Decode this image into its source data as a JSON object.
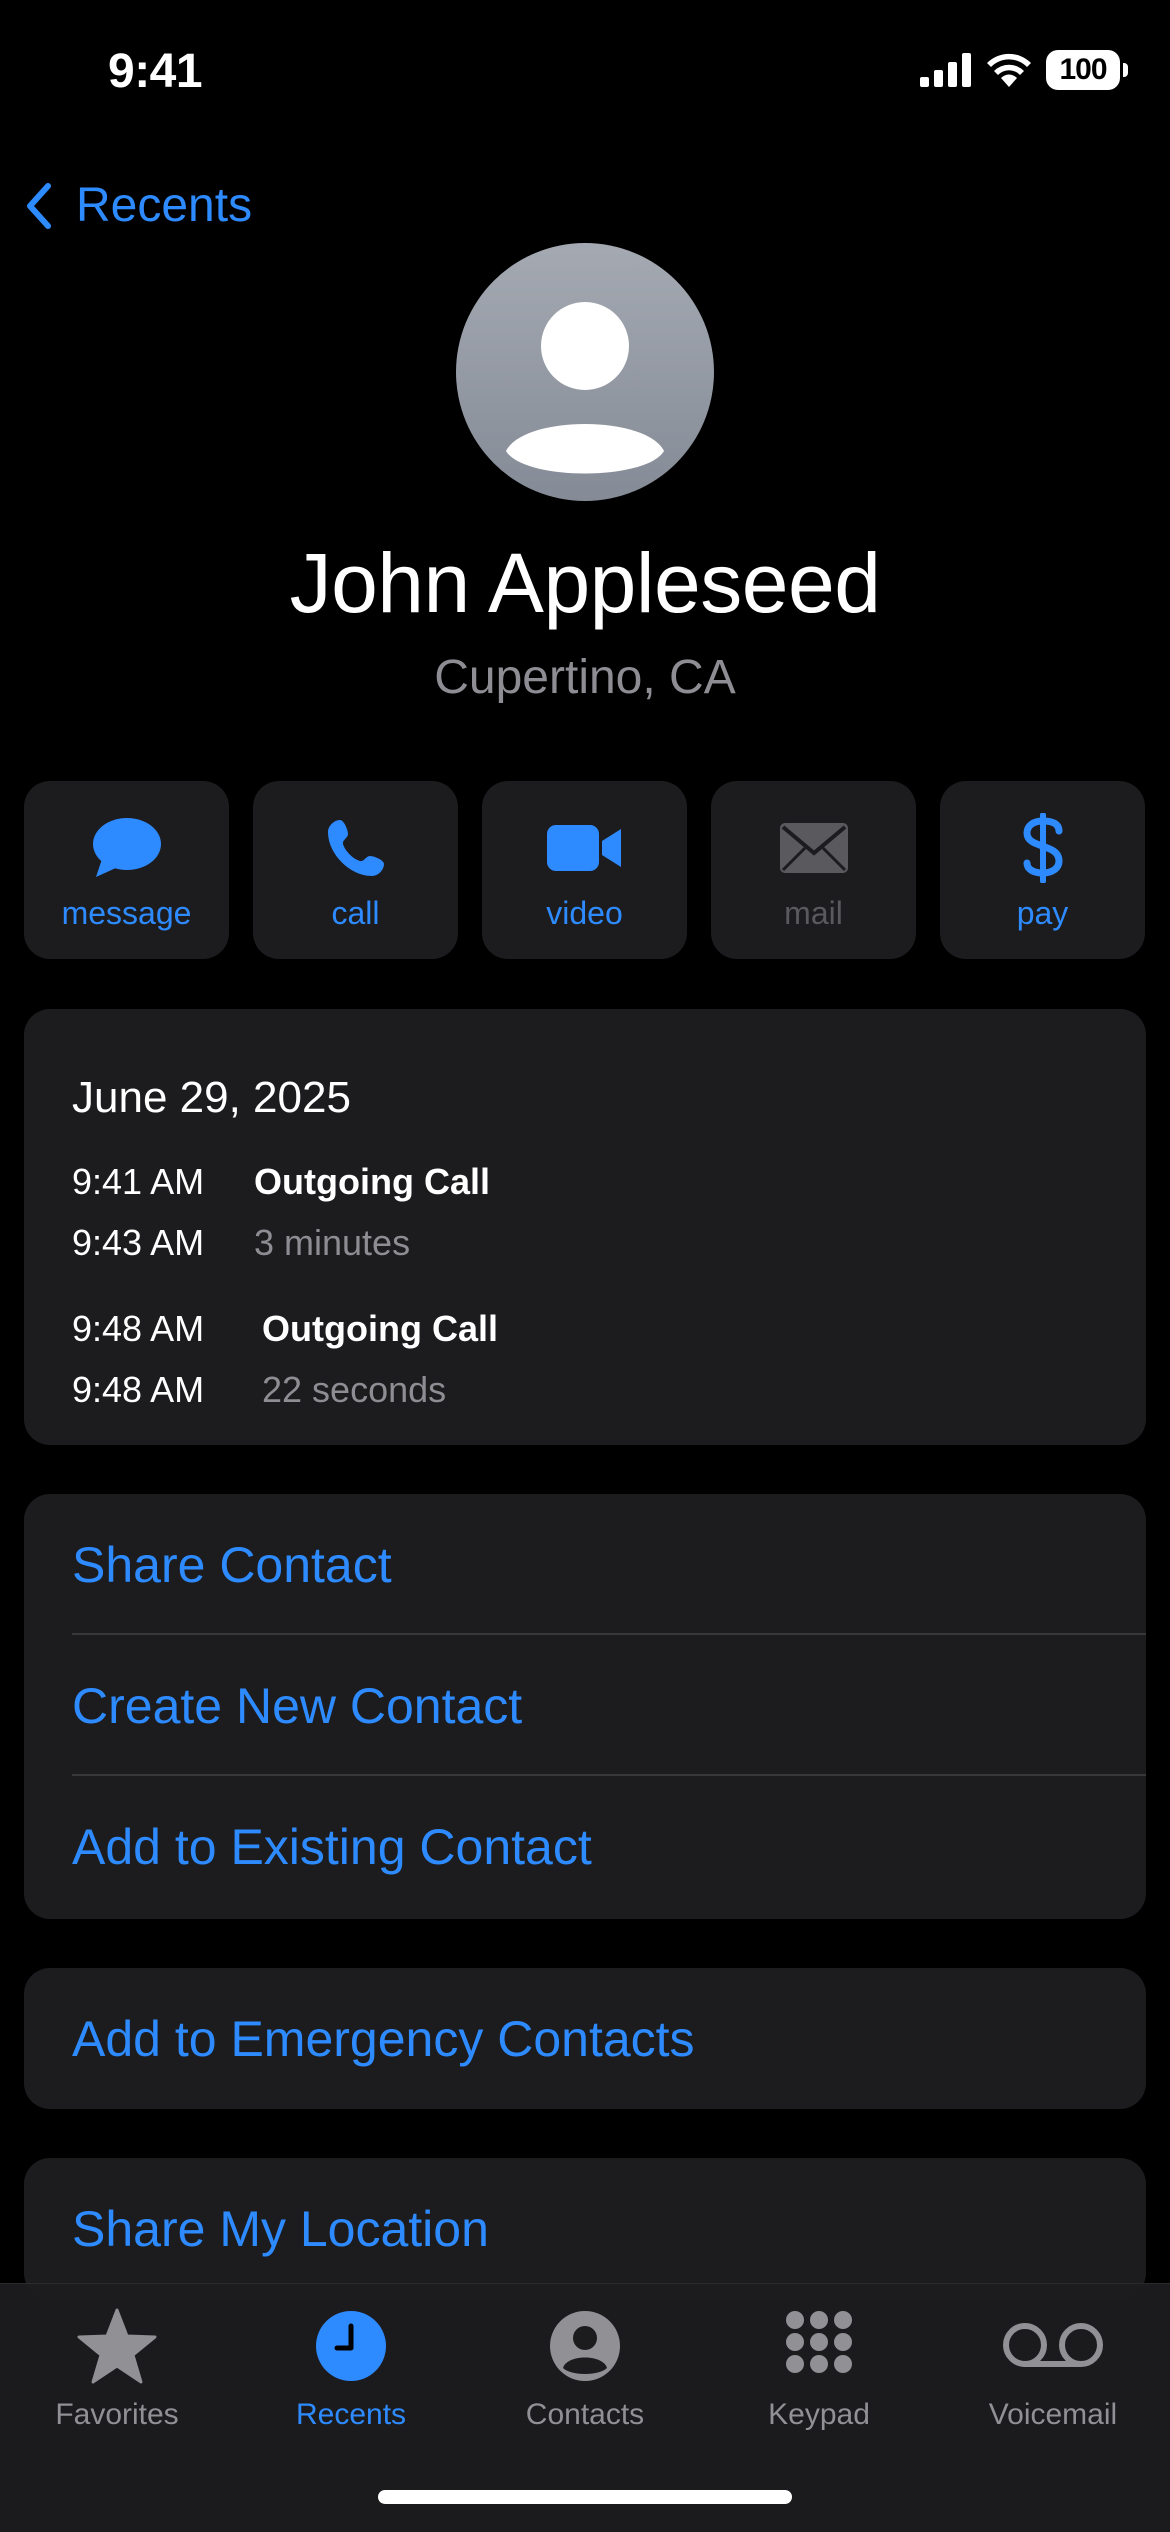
{
  "status_bar": {
    "time": "9:41",
    "battery": "100"
  },
  "nav": {
    "back_label": "Recents"
  },
  "contact": {
    "name": "John Appleseed",
    "location": "Cupertino, CA"
  },
  "actions": [
    {
      "label": "message",
      "icon": "message-bubble-icon",
      "enabled": true
    },
    {
      "label": "call",
      "icon": "phone-icon",
      "enabled": true
    },
    {
      "label": "video",
      "icon": "video-camera-icon",
      "enabled": true
    },
    {
      "label": "mail",
      "icon": "envelope-icon",
      "enabled": false
    },
    {
      "label": "pay",
      "icon": "dollar-icon",
      "enabled": true
    }
  ],
  "call_history": {
    "date": "June 29, 2025",
    "entries": [
      {
        "start": "9:41 AM",
        "type": "Outgoing Call",
        "end": "9:43 AM",
        "duration": "3 minutes"
      },
      {
        "start": "9:48 AM",
        "type": "Outgoing Call",
        "end": "9:48 AM",
        "duration": "22 seconds"
      }
    ]
  },
  "options": [
    "Share Contact",
    "Create New Contact",
    "Add to Existing Contact"
  ],
  "emergency": {
    "label": "Add to Emergency Contacts"
  },
  "location": {
    "label": "Share My Location"
  },
  "tabs": [
    {
      "label": "Favorites",
      "icon": "star-icon"
    },
    {
      "label": "Recents",
      "icon": "clock-icon",
      "active": true
    },
    {
      "label": "Contacts",
      "icon": "person-circle-icon"
    },
    {
      "label": "Keypad",
      "icon": "keypad-icon"
    },
    {
      "label": "Voicemail",
      "icon": "voicemail-icon"
    }
  ],
  "colors": {
    "accent": "#2e8bff",
    "card": "#1c1c1e",
    "secondary_text": "#8d8d93"
  }
}
